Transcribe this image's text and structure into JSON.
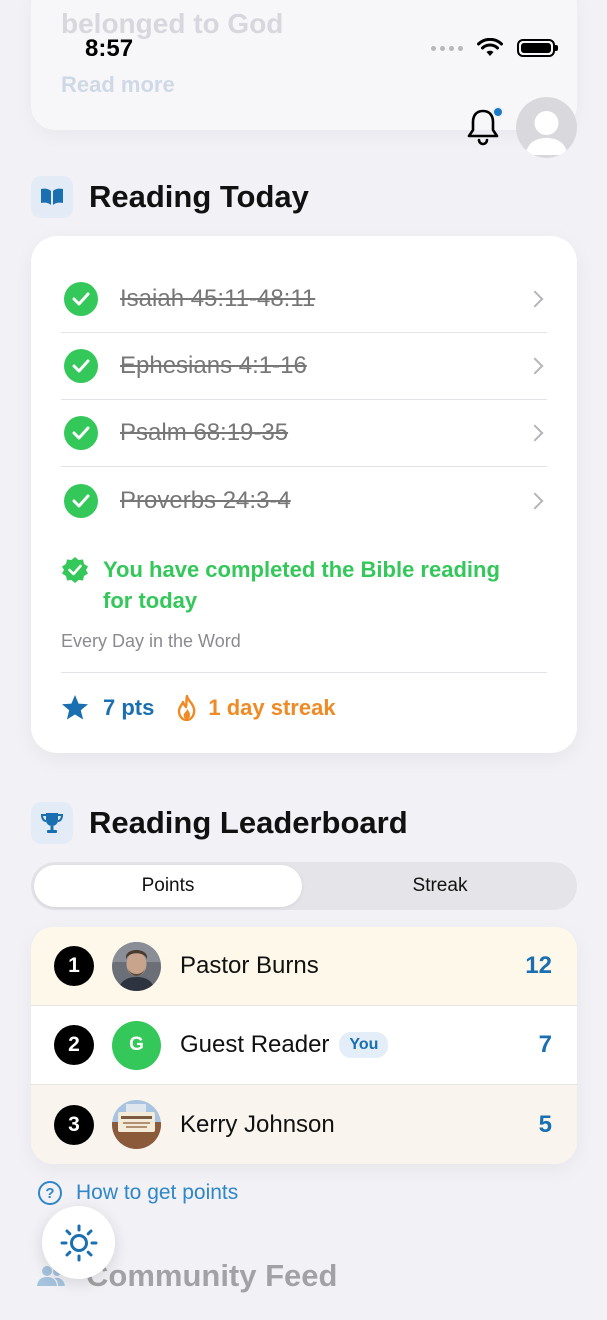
{
  "status_bar": {
    "time": "8:57"
  },
  "background_card": {
    "title": "belonged to God",
    "read_more": "Read more"
  },
  "header": {
    "notification_dot": true
  },
  "reading_today": {
    "title": "Reading Today",
    "items": [
      {
        "label": "Isaiah 45:11-48:11",
        "completed": true
      },
      {
        "label": "Ephesians 4:1-16",
        "completed": true
      },
      {
        "label": "Psalm 68:19-35",
        "completed": true
      },
      {
        "label": "Proverbs 24:3-4",
        "completed": true
      }
    ],
    "completion_message": "You have completed the Bible reading for today",
    "plan_name": "Every Day in the Word",
    "points_label": "7 pts",
    "streak_label": "1 day streak"
  },
  "leaderboard": {
    "title": "Reading Leaderboard",
    "tabs": {
      "points": "Points",
      "streak": "Streak"
    },
    "active_tab": "Points",
    "rows": [
      {
        "rank": "1",
        "name": "Pastor Burns",
        "score": "12",
        "highlight": "#fdf8ea"
      },
      {
        "rank": "2",
        "name": "Guest Reader",
        "initial": "G",
        "you_badge": "You",
        "score": "7",
        "highlight": "#ffffff"
      },
      {
        "rank": "3",
        "name": "Kerry Johnson",
        "score": "5",
        "highlight": "#f9f5ee"
      }
    ],
    "how_link": "How to get points"
  },
  "community_feed": {
    "title": "Community Feed"
  },
  "colors": {
    "accent": "#1a6fb0",
    "success": "#34c759",
    "streak": "#f08a24"
  }
}
